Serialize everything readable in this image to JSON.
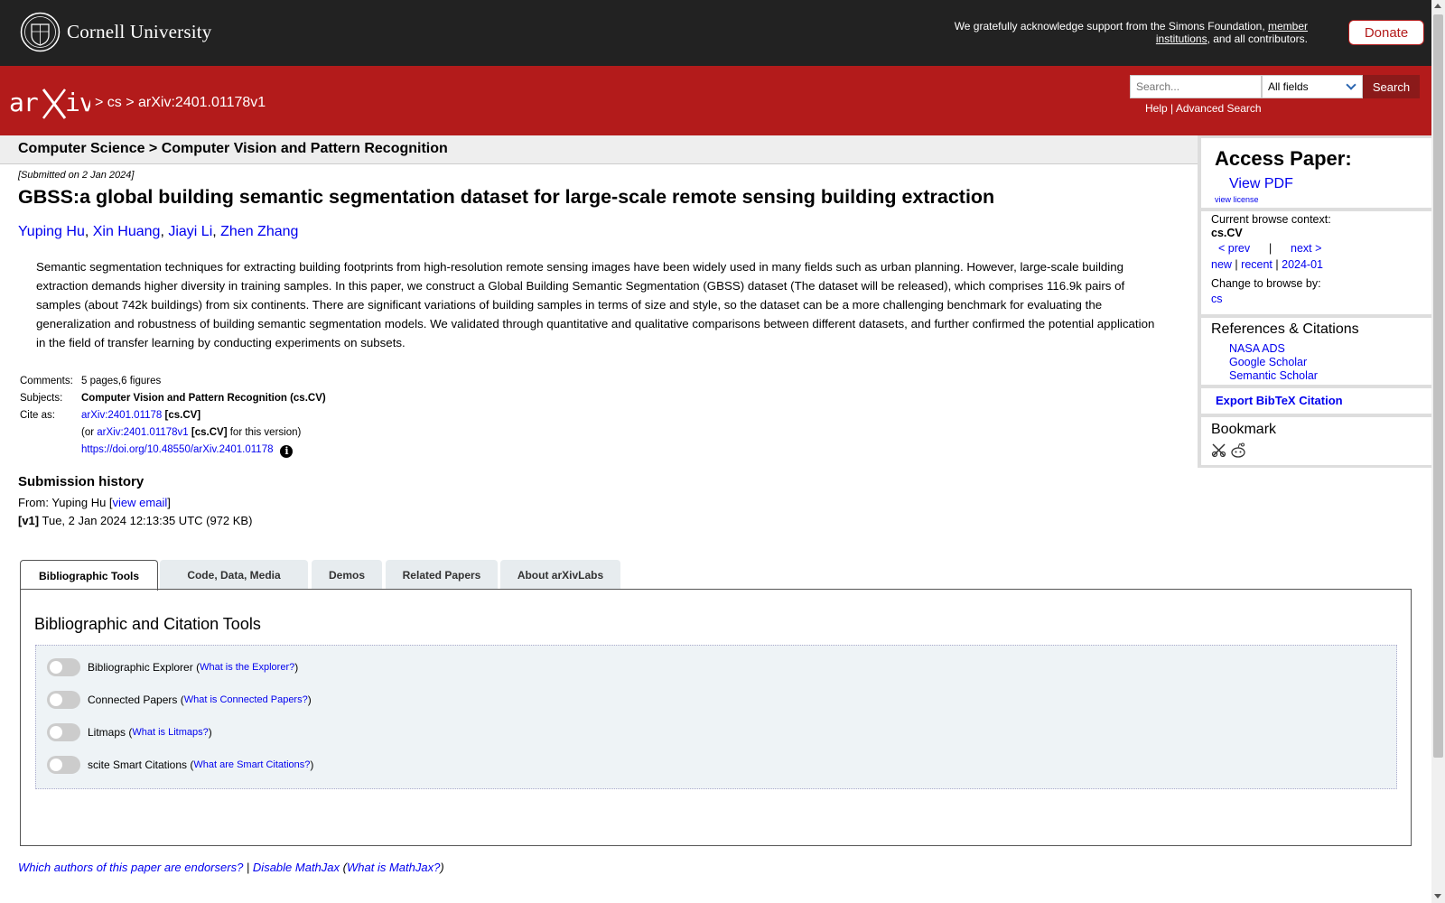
{
  "top": {
    "brand": "Cornell University",
    "ack_text": "We gratefully acknowledge support from the Simons Foundation, ",
    "ack_link": "member institutions",
    "ack_end": ", and all contributors.",
    "donate": "Donate"
  },
  "header": {
    "breadcrumb": "> cs > arXiv:2401.01178v1",
    "search_placeholder": "Search...",
    "search_field": "All fields",
    "search_button": "Search",
    "help": "Help",
    "sep": " | ",
    "advanced": "Advanced Search"
  },
  "category": "Computer Science > Computer Vision and Pattern Recognition",
  "paper": {
    "submitted": "[Submitted on 2 Jan 2024]",
    "title": "GBSS:a global building semantic segmentation dataset for large-scale remote sensing building extraction",
    "authors": [
      "Yuping Hu",
      "Xin Huang",
      "Jiayi Li",
      "Zhen Zhang"
    ],
    "comma": ", ",
    "abstract": "Semantic segmentation techniques for extracting building footprints from high-resolution remote sensing images have been widely used in many fields such as urban planning. However, large-scale building extraction demands higher diversity in training samples. In this paper, we construct a Global Building Semantic Segmentation (GBSS) dataset (The dataset will be released), which comprises 116.9k pairs of samples (about 742k buildings) from six continents. There are significant variations of building samples in terms of size and style, so the dataset can be a more challenging benchmark for evaluating the generalization and robustness of building semantic segmentation models. We validated through quantitative and qualitative comparisons between different datasets, and further confirmed the potential application in the field of transfer learning by conducting experiments on subsets."
  },
  "meta": {
    "comments_label": "Comments:",
    "comments": "5 pages,6 figures",
    "subjects_label": "Subjects:",
    "subjects": "Computer Vision and Pattern Recognition (cs.CV)",
    "cite_label": "Cite as:",
    "cite_link": "arXiv:2401.01178",
    "cite_tag": "[cs.CV]",
    "or_open": "(or ",
    "version_link": "arXiv:2401.01178v1",
    "version_tag": "[cs.CV]",
    "version_end": " for this version)",
    "doi": "https://doi.org/10.48550/arXiv.2401.01178",
    "info_glyph": "i"
  },
  "history": {
    "title": "Submission history",
    "from_prefix": "From: Yuping Hu [",
    "view_email": "view email",
    "from_suffix": "]",
    "v1_tag": "[v1]",
    "v1_text": " Tue, 2 Jan 2024 12:13:35 UTC (972 KB)"
  },
  "sidebar": {
    "access_title": "Access Paper:",
    "view_pdf": "View PDF",
    "view_license": "view license",
    "context_label": "Current browse context:",
    "context": "cs.CV",
    "prev": "< prev",
    "pipe": "|",
    "next": "next >",
    "new": "new",
    "recent": "recent",
    "month": "2024-01",
    "change_label": "Change to browse by:",
    "cs": "cs",
    "refs_title": "References & Citations",
    "refs": [
      "NASA ADS",
      "Google Scholar",
      "Semantic Scholar"
    ],
    "export": "Export BibTeX Citation",
    "bookmark_title": "Bookmark"
  },
  "tabs": [
    "Bibliographic Tools",
    "Code, Data, Media",
    "Demos",
    "Related Papers",
    "About arXivLabs"
  ],
  "panel": {
    "title": "Bibliographic and Citation Tools",
    "tools": [
      {
        "name": "Bibliographic Explorer",
        "link": "What is the Explorer?"
      },
      {
        "name": "Connected Papers",
        "link": "What is Connected Papers?"
      },
      {
        "name": "Litmaps",
        "link": "What is Litmaps?"
      },
      {
        "name": "scite Smart Citations",
        "link": "What are Smart Citations?"
      }
    ]
  },
  "footer": {
    "endorsers": "Which authors of this paper are endorsers?",
    "sep": " | ",
    "disable_mathjax": "Disable MathJax",
    "open": " (",
    "what_mathjax": "What is MathJax?",
    "close": ")"
  },
  "colors": {
    "arxiv_red": "#b31b1b",
    "top_bar": "#222222",
    "link": "#0000ee"
  },
  "icons": [
    "cornell-seal-icon",
    "arxiv-logo-icon",
    "chevron-down-icon",
    "info-icon",
    "bibsonomy-icon",
    "reddit-icon"
  ]
}
